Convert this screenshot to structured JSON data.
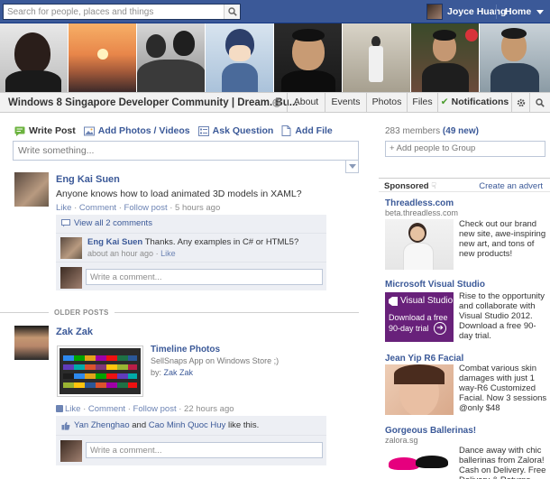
{
  "topbar": {
    "search_placeholder": "Search for people, places and things",
    "user_name": "Joyce Huang",
    "home_label": "Home"
  },
  "group": {
    "title": "Windows 8 Singapore Developer Community | Dream. Bu...",
    "tabs": [
      "About",
      "Events",
      "Photos",
      "Files",
      "Notifications"
    ]
  },
  "composer": {
    "actions": [
      "Write Post",
      "Add Photos / Videos",
      "Ask Question",
      "Add File"
    ],
    "placeholder": "Write something..."
  },
  "post1": {
    "author": "Eng Kai Suen",
    "text": "Anyone knows how to load animated 3D models in XAML?",
    "like": "Like",
    "comment": "Comment",
    "follow": "Follow post",
    "time": "5 hours ago",
    "view_all": "View all 2 comments",
    "reply_author": "Eng Kai Suen",
    "reply_text": "Thanks. Any examples in C# or HTML5?",
    "reply_time": "about an hour ago",
    "reply_like": "Like",
    "comment_placeholder": "Write a comment..."
  },
  "older_posts": "OLDER POSTS",
  "post2": {
    "author": "Zak Zak",
    "attach_title": "Timeline Photos",
    "attach_desc": "SellSnaps App on Windows Store ;)",
    "attach_by": "by:",
    "attach_by_name": "Zak Zak",
    "like": "Like",
    "comment": "Comment",
    "follow": "Follow post",
    "time": "22 hours ago",
    "liker1": "Yan Zhenghao",
    "and": "and",
    "liker2": "Cao Minh Quoc Huy",
    "likes_suffix": "like this.",
    "comment_placeholder": "Write a comment..."
  },
  "right": {
    "members": "283 members",
    "new_members": "(49 new)",
    "add_people": "+ Add people to Group",
    "sponsored": "Sponsored",
    "create_ad": "Create an advert",
    "ads": [
      {
        "title": "Threadless.com",
        "url": "beta.threadless.com",
        "text": "Check out our brand new site, awe-inspiring new art, and tons of new products!"
      },
      {
        "title": "Microsoft Visual Studio",
        "url": "",
        "text": "Rise to the opportunity and collaborate with Visual Studio 2012. Download a free 90-day trial.",
        "img_brand": "Visual Studio",
        "img_line1": "Download a free",
        "img_line2": "90-day trial"
      },
      {
        "title": "Jean Yip R6 Facial",
        "url": "",
        "text": "Combat various skin damages with just 1 way-R6 Customized Facial. Now 3 sessions @only $48"
      },
      {
        "title": "Gorgeous Ballerinas!",
        "url": "zalora.sg",
        "text": "Dance away with chic ballerinas from Zalora! Cash on Delivery. Free Delivery & Returns."
      }
    ]
  },
  "colors": {
    "brand_blue": "#3b5998",
    "link_blue": "#3b5998",
    "vs_purple": "#68217a"
  }
}
